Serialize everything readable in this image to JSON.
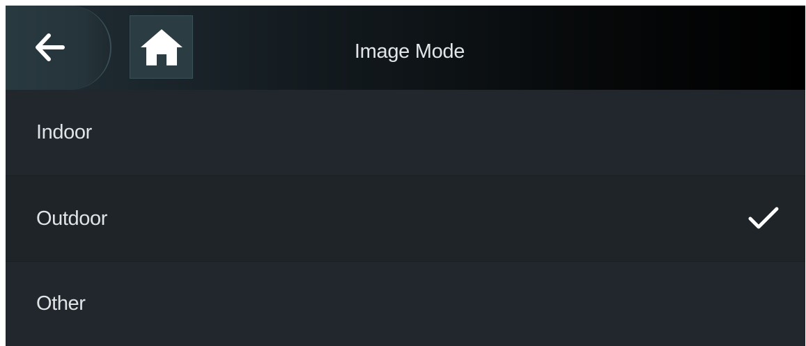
{
  "header": {
    "title": "Image Mode",
    "back_icon": "arrow-left-icon",
    "home_icon": "home-icon"
  },
  "options": [
    {
      "label": "Indoor",
      "selected": false
    },
    {
      "label": "Outdoor",
      "selected": true
    },
    {
      "label": "Other",
      "selected": false
    }
  ],
  "colors": {
    "background": "#20252b",
    "header_dark": "#000000",
    "text": "#e1e4e6",
    "check": "#ffffff"
  }
}
